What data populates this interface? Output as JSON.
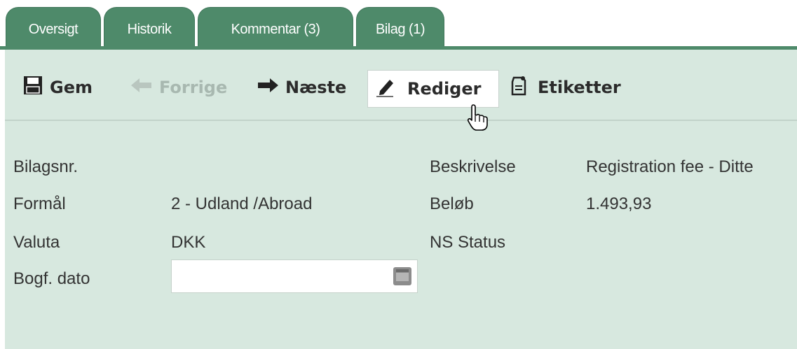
{
  "tabs": [
    {
      "label": "Oversigt"
    },
    {
      "label": "Historik"
    },
    {
      "label": "Kommentar (3)"
    },
    {
      "label": "Bilag (1)"
    }
  ],
  "toolbar": {
    "save_label": "Gem",
    "prev_label": "Forrige",
    "next_label": "Næste",
    "edit_label": "Rediger",
    "tags_label": "Etiketter"
  },
  "form": {
    "left": [
      {
        "label": "Bilagsnr.",
        "value": ""
      },
      {
        "label": "Formål",
        "value": "2 - Udland /Abroad"
      },
      {
        "label": "Valuta",
        "value": "DKK"
      },
      {
        "label": "Bogf. dato",
        "value": ""
      }
    ],
    "right": [
      {
        "label": "Beskrivelse",
        "value": "Registration fee - Ditte"
      },
      {
        "label": "Beløb",
        "value": "1.493,93"
      },
      {
        "label": "NS Status",
        "value": ""
      }
    ]
  },
  "colors": {
    "tab": "#4e8a6a",
    "panel": "#d7e8df",
    "disabled": "#a8b8b0"
  },
  "icons": [
    "save-icon",
    "arrow-left-icon",
    "arrow-right-icon",
    "pencil-icon",
    "tag-icon",
    "calendar-icon",
    "hand-cursor-icon"
  ]
}
